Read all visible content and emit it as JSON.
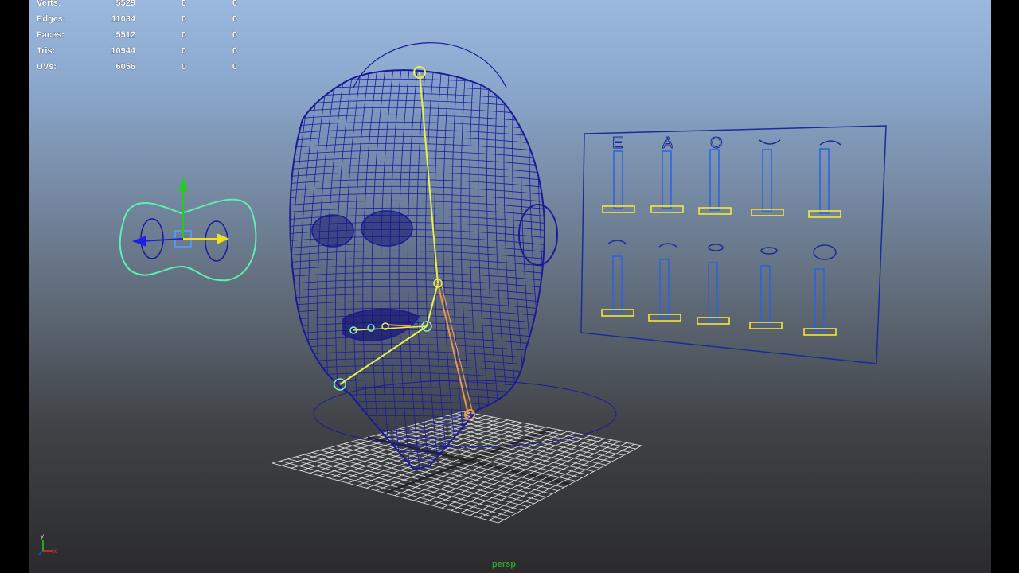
{
  "hud": {
    "rows": [
      {
        "label": "Verts:",
        "values": [
          "5529",
          "0",
          "0"
        ]
      },
      {
        "label": "Edges:",
        "values": [
          "11034",
          "0",
          "0"
        ]
      },
      {
        "label": "Faces:",
        "values": [
          "5512",
          "0",
          "0"
        ]
      },
      {
        "label": "Tris:",
        "values": [
          "10944",
          "0",
          "0"
        ]
      },
      {
        "label": "UVs:",
        "values": [
          "6056",
          "0",
          "0"
        ]
      }
    ]
  },
  "viewport": {
    "camera": "persp",
    "colors": {
      "wireframe": "#1a1a9a",
      "selected_joint": "#e6f24a",
      "joint_orange": "#e89a50",
      "control_curve": "#5bf0b0",
      "panel_outline": "#1b2c9a",
      "slider_track": "#2a62e0",
      "slider_handle": "#ffee33",
      "grid": "#ffffff"
    }
  },
  "phoneme_panel": {
    "top_labels": [
      "E",
      "A",
      "O"
    ]
  },
  "axis_indicator": {
    "y": "y",
    "x": "x"
  }
}
